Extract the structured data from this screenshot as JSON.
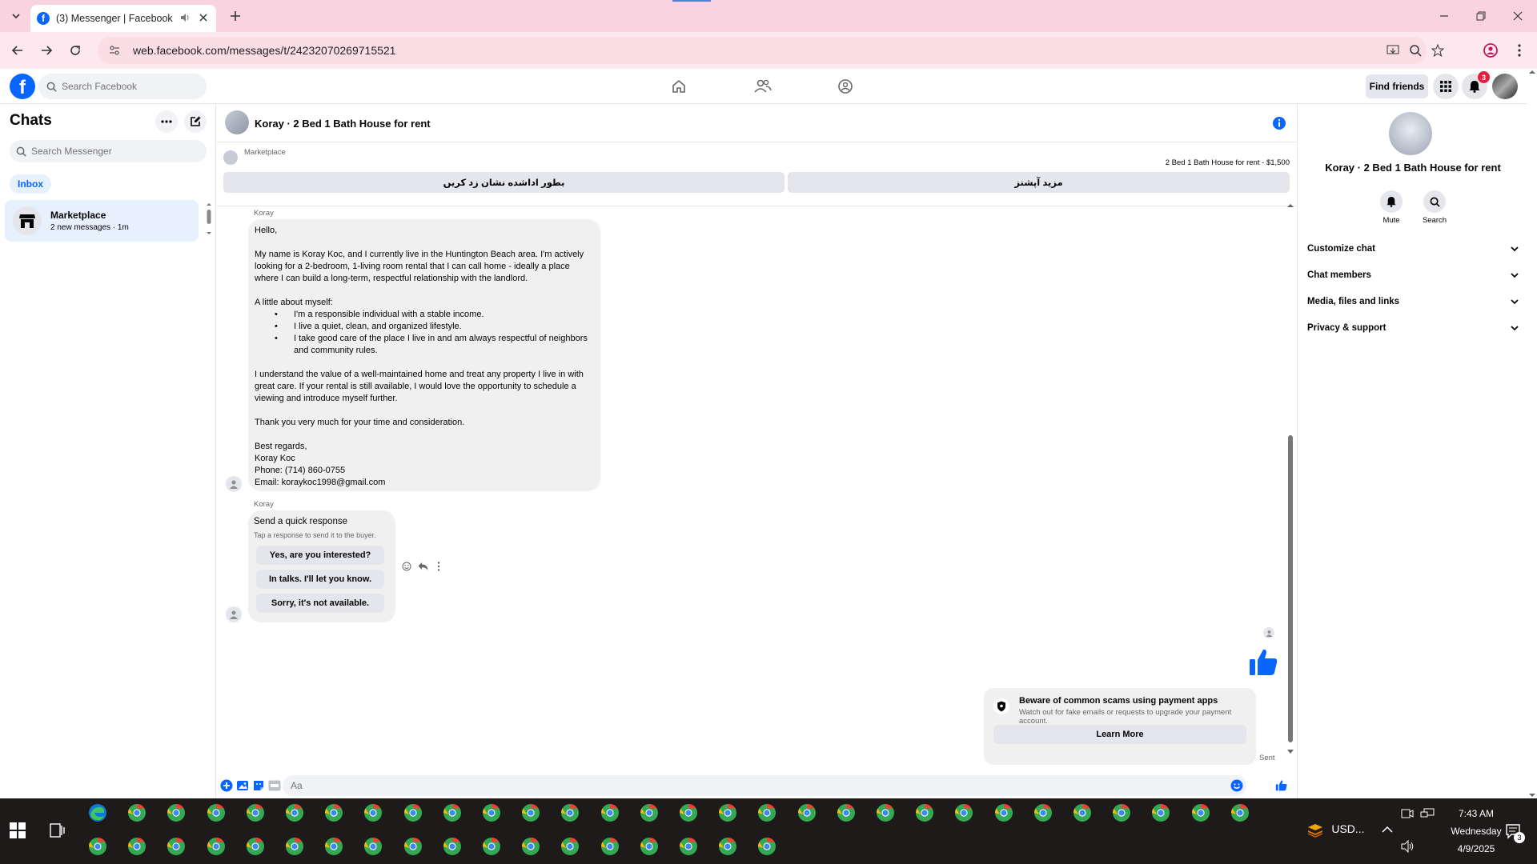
{
  "browser": {
    "tab_title": "(3) Messenger | Facebook",
    "url": "web.facebook.com/messages/t/24232070269715521"
  },
  "fb": {
    "search_placeholder": "Search Facebook",
    "find_friends": "Find friends",
    "notifications_count": "3"
  },
  "left": {
    "title": "Chats",
    "search_placeholder": "Search Messenger",
    "inbox": "Inbox",
    "chat_items": [
      {
        "name": "Marketplace",
        "subtitle": "2 new messages · 1m"
      }
    ]
  },
  "conversation": {
    "title": "Koray · 2 Bed 1 Bath House for rent",
    "marketplace_label": "Marketplace",
    "listing": "2 Bed 1 Bath House for rent - $1,500",
    "btn_mark_pending": "بطور اداشده نشان زد کریں",
    "btn_more_options": "مزید آپشنز",
    "messages": [
      {
        "sender": "Koray",
        "greeting": "Hello,",
        "para1": "My name is Koray Koc, and I currently live in the Huntington Beach area. I'm actively looking for a 2-bedroom, 1-living room rental that I can call home - ideally a place where I can build a long-term, respectful relationship with the landlord.",
        "about": "A little about myself:",
        "bullets": [
          "I'm a responsible individual with a stable income.",
          "I live a quiet, clean, and organized lifestyle.",
          "I take good care of the place I live in and am always respectful of neighbors and community rules."
        ],
        "para2": "I understand the value of a well-maintained home and treat any property I live in with great care. If your rental is still available, I would love the opportunity to schedule a viewing and introduce myself further.",
        "thanks": "Thank you very much for your time and consideration.",
        "signoff": "Best regards,",
        "signame": "Koray Koc",
        "phone": "Phone: (714) 860-0755",
        "email": "Email: koraykoc1998@gmail.com"
      }
    ],
    "quick": {
      "sender": "Koray",
      "title": "Send a quick response",
      "subtitle": "Tap a response to send it to the buyer.",
      "options": [
        "Yes, are you interested?",
        "In talks. I'll let you know.",
        "Sorry, it's not available."
      ]
    },
    "scam": {
      "title": "Beware of common scams using payment apps",
      "text": "Watch out for fake emails or requests to upgrade your payment account.",
      "button": "Learn More"
    },
    "sent_status": "Sent",
    "composer_placeholder": "Aa"
  },
  "right": {
    "name": "Koray · 2 Bed 1 Bath House for rent",
    "actions": [
      {
        "label": "Mute",
        "icon": "bell-icon"
      },
      {
        "label": "Search",
        "icon": "search-icon"
      }
    ],
    "sections": [
      "Customize chat",
      "Chat members",
      "Media, files and links",
      "Privacy & support"
    ]
  },
  "taskbar": {
    "tray_label": "USD...",
    "time": "7:43 AM",
    "day": "Wednesday",
    "date": "4/9/2025",
    "notification_count": "3"
  },
  "colors": {
    "fb_blue": "#0866ff",
    "titlebar": "#f9d3df",
    "taskbar": "#1f1a1a"
  }
}
